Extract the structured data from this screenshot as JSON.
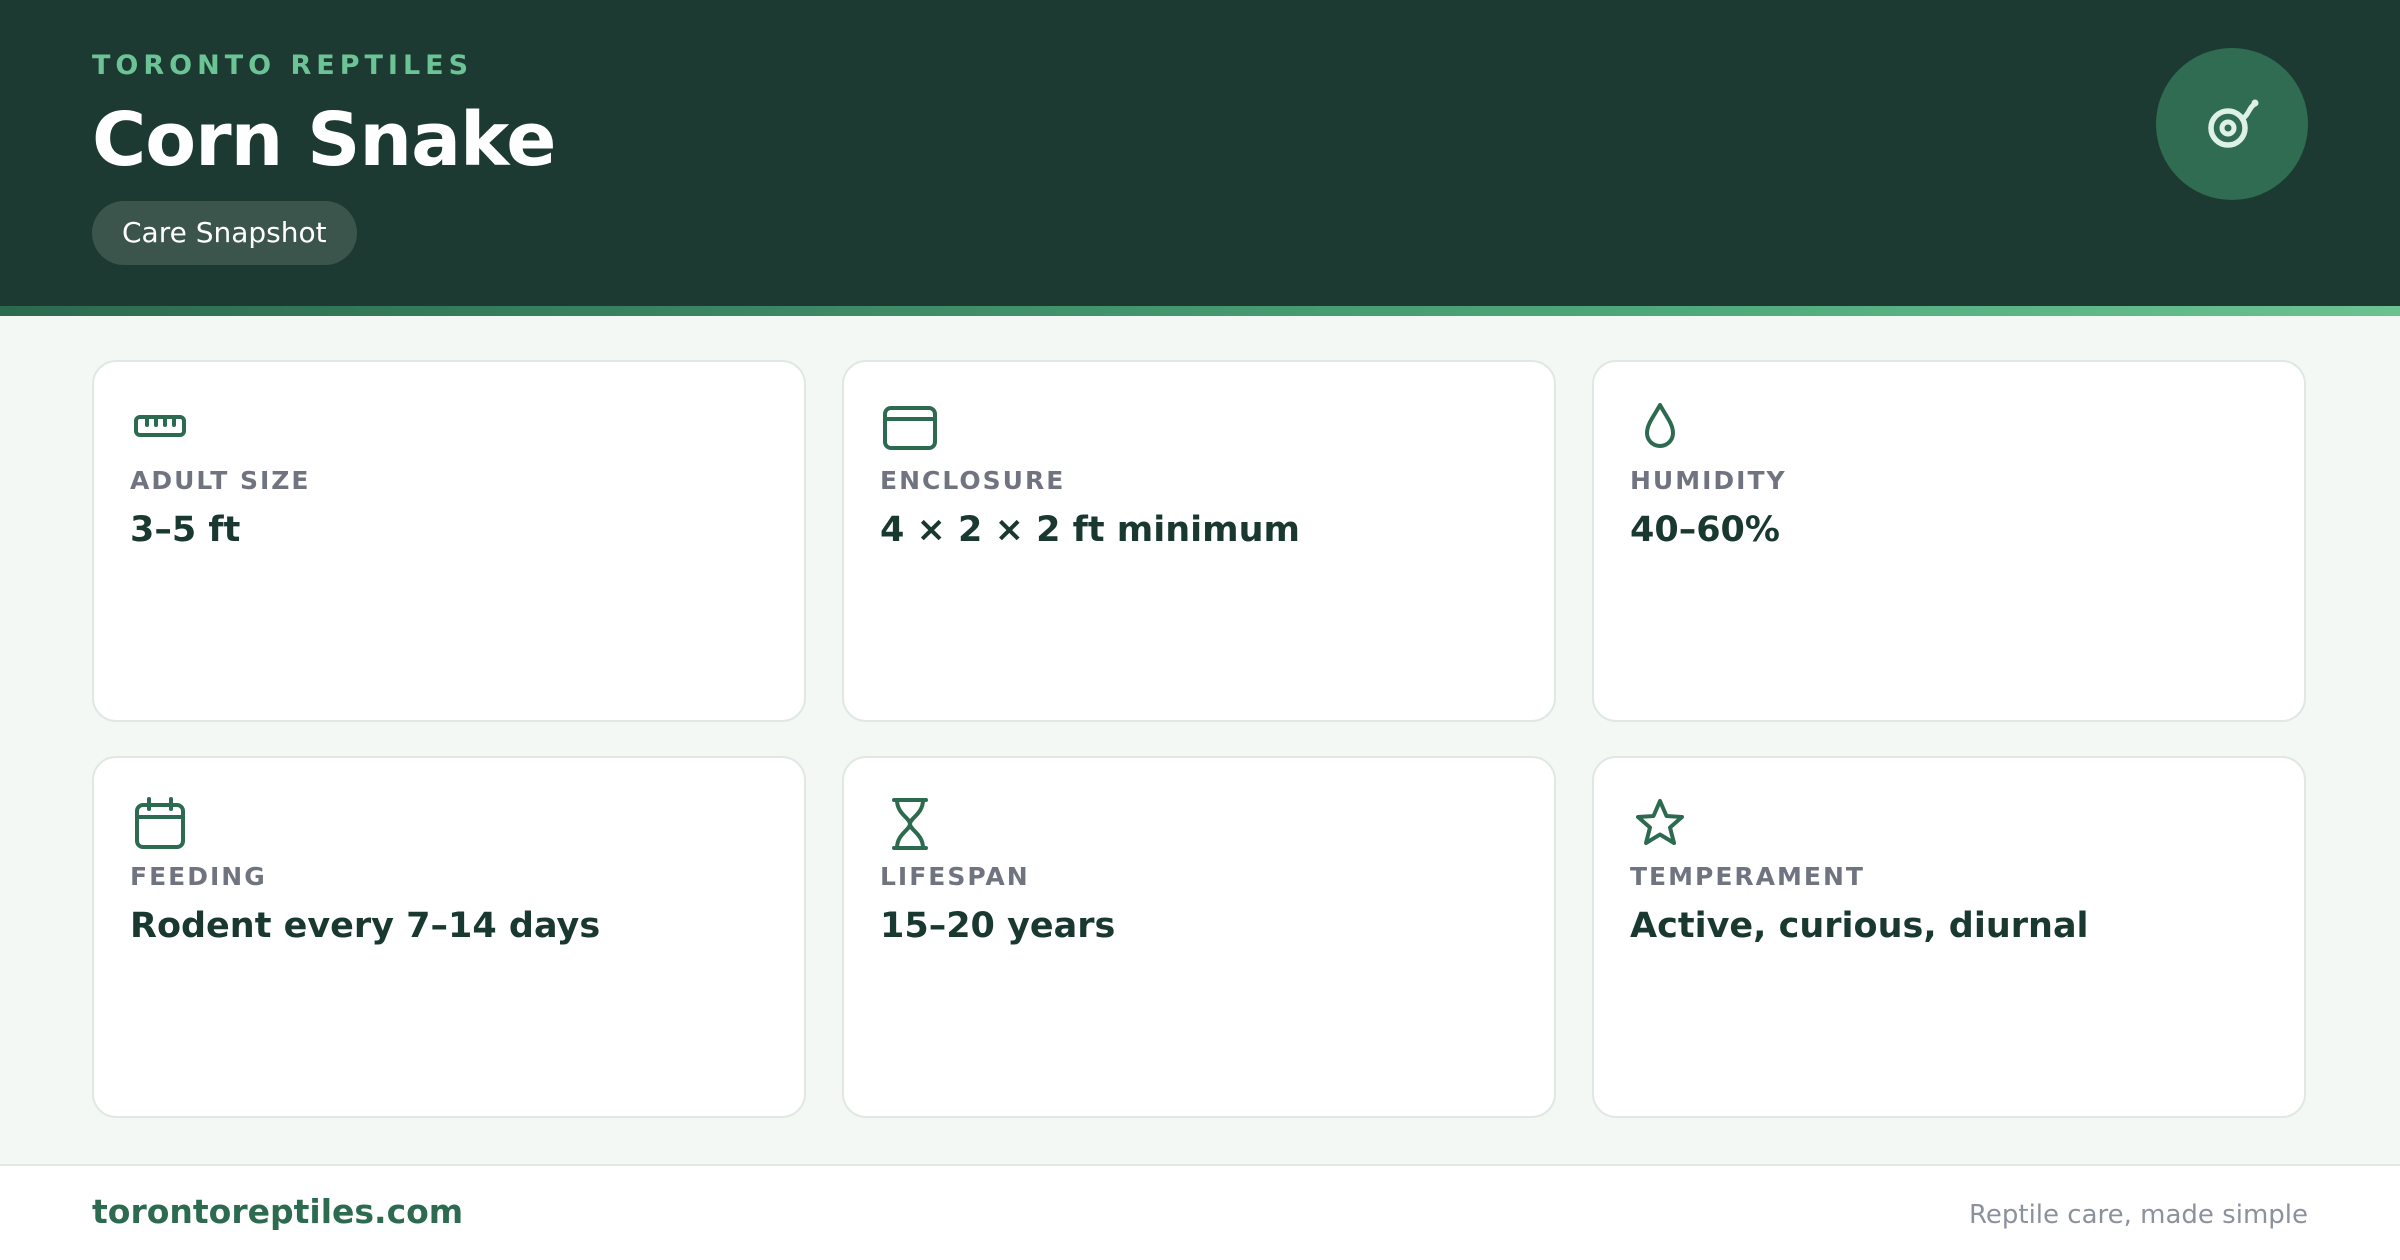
{
  "header": {
    "brand": "TORONTO REPTILES",
    "title": "Corn Snake",
    "badge": "Care Snapshot",
    "logo_icon": "snake-coil-icon"
  },
  "facts": [
    {
      "icon": "ruler-icon",
      "label": "ADULT SIZE",
      "value": "3–5 ft"
    },
    {
      "icon": "enclosure-icon",
      "label": "ENCLOSURE",
      "value": "4 × 2 × 2 ft minimum"
    },
    {
      "icon": "water-drop-icon",
      "label": "HUMIDITY",
      "value": "40–60%"
    },
    {
      "icon": "calendar-icon",
      "label": "FEEDING",
      "value": "Rodent every 7–14 days"
    },
    {
      "icon": "hourglass-icon",
      "label": "LIFESPAN",
      "value": "15–20 years"
    },
    {
      "icon": "star-icon",
      "label": "TEMPERAMENT",
      "value": "Active, curious, diurnal"
    }
  ],
  "footer": {
    "site": "torontoreptiles.com",
    "tagline": "Reptile care, made simple"
  },
  "colors": {
    "header_bg": "#1c3a31",
    "accent": "#6cc496",
    "icon": "#2d6b50",
    "page_bg": "#f3f8f5"
  }
}
